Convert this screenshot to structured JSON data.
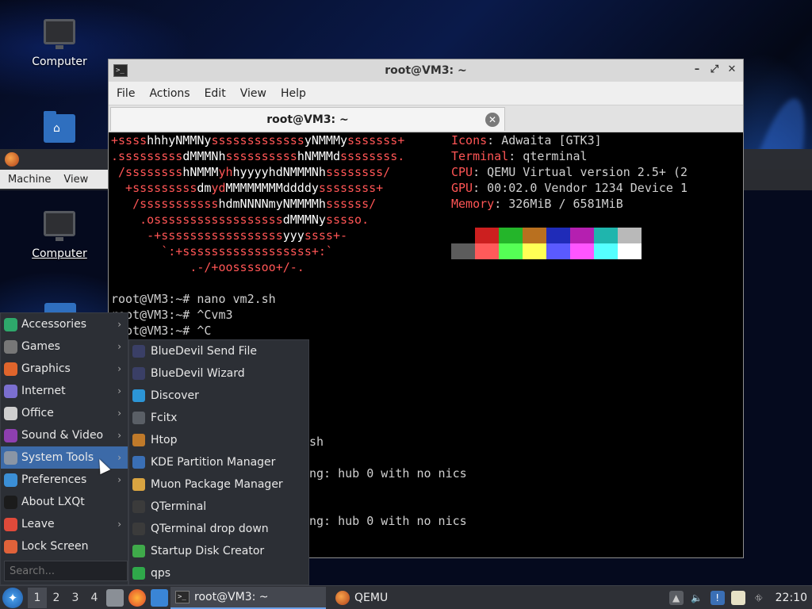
{
  "desktop": {
    "icons": [
      {
        "label": "Computer"
      },
      {
        "label": "Computer"
      }
    ]
  },
  "qemu": {
    "menubar": [
      "Machine",
      "View"
    ]
  },
  "terminal": {
    "window_title": "root@VM3: ~",
    "menubar": [
      "File",
      "Actions",
      "Edit",
      "View",
      "Help"
    ],
    "tab_title": "root@VM3: ~",
    "ascii_art": [
      {
        "segments": [
          [
            "red",
            "+ssss"
          ],
          [
            "w",
            "hhhyNMMNy"
          ],
          [
            "red",
            "sssssssssssss"
          ],
          [
            "w",
            "yNMMMy"
          ],
          [
            "red",
            "sssssss+"
          ]
        ]
      },
      {
        "segments": [
          [
            "red",
            ".sssssssss"
          ],
          [
            "w",
            "dMMMNh"
          ],
          [
            "red",
            "ssssssssss"
          ],
          [
            "w",
            "hNMMMd"
          ],
          [
            "red",
            "ssssssss."
          ]
        ]
      },
      {
        "segments": [
          [
            "red",
            " /ssssssss"
          ],
          [
            "w",
            "hNMMM"
          ],
          [
            "red",
            "yh"
          ],
          [
            "w",
            "hyyyyhdNMMMNh"
          ],
          [
            "red",
            "ssssssss/"
          ]
        ]
      },
      {
        "segments": [
          [
            "red",
            "  +sssssssss"
          ],
          [
            "w",
            "dm"
          ],
          [
            "red",
            "yd"
          ],
          [
            "w",
            "MMMMMMMMddddy"
          ],
          [
            "red",
            "ssssssss+"
          ]
        ]
      },
      {
        "segments": [
          [
            "red",
            "   /sssssssssss"
          ],
          [
            "w",
            "hdmNNNNmyNMMMMh"
          ],
          [
            "red",
            "ssssss/"
          ]
        ]
      },
      {
        "segments": [
          [
            "red",
            "    .ossssssssssssssssss"
          ],
          [
            "w",
            "dMMMNy"
          ],
          [
            "red",
            "sssso."
          ]
        ]
      },
      {
        "segments": [
          [
            "red",
            "     -+sssssssssssssssss"
          ],
          [
            "w",
            "yyy"
          ],
          [
            "red",
            "ssss+-"
          ]
        ]
      },
      {
        "segments": [
          [
            "red",
            "       `:+ssssssssssssssssss+:`"
          ]
        ]
      },
      {
        "segments": [
          [
            "red",
            "           .-/+oossssoo+/-."
          ]
        ]
      }
    ],
    "sysinfo": [
      {
        "label": "Icons",
        "value": "Adwaita [GTK3]"
      },
      {
        "label": "Terminal",
        "value": "qterminal"
      },
      {
        "label": "CPU",
        "value": "QEMU Virtual version 2.5+ (2"
      },
      {
        "label": "GPU",
        "value": "00:02.0 Vendor 1234 Device 1"
      },
      {
        "label": "Memory",
        "value": "326MiB / 6581MiB"
      }
    ],
    "palette_top": [
      "#000000",
      "#cc1f1f",
      "#24b52a",
      "#b9701f",
      "#1f2bb8",
      "#b51fb0",
      "#1fb5ad",
      "#b9b9b9"
    ],
    "palette_bottom": [
      "#5c5c5c",
      "#ff5a5a",
      "#55ff55",
      "#ffff55",
      "#5a5aff",
      "#ff55ff",
      "#55ffff",
      "#ffffff"
    ],
    "lines": [
      "root@VM3:~# nano vm2.sh",
      "root@VM3:~# ^Cvm3",
      "root@VM3:~# ^C",
      "sh",
      "ng: hub 0 with no nics",
      "ng: hub 0 with no nics"
    ]
  },
  "start_menu": {
    "items": [
      {
        "label": "Accessories",
        "icon": "accessories-icon",
        "color": "#2ea86b",
        "submenu": true
      },
      {
        "label": "Games",
        "icon": "games-icon",
        "color": "#777777",
        "submenu": true
      },
      {
        "label": "Graphics",
        "icon": "graphics-icon",
        "color": "#e0652c",
        "submenu": true
      },
      {
        "label": "Internet",
        "icon": "internet-icon",
        "color": "#7b6fd0",
        "submenu": true
      },
      {
        "label": "Office",
        "icon": "office-icon",
        "color": "#cfcfcf",
        "submenu": true
      },
      {
        "label": "Sound & Video",
        "icon": "sound-video-icon",
        "color": "#8e3fb0",
        "submenu": true
      },
      {
        "label": "System Tools",
        "icon": "system-tools-icon",
        "color": "#8a95a5",
        "submenu": true
      },
      {
        "label": "Preferences",
        "icon": "preferences-icon",
        "color": "#3b8fd6",
        "submenu": true
      },
      {
        "label": "About LXQt",
        "icon": "about-icon",
        "color": "#1b1b1b",
        "submenu": false
      },
      {
        "label": "Leave",
        "icon": "leave-icon",
        "color": "#e04a3a",
        "submenu": true
      },
      {
        "label": "Lock Screen",
        "icon": "lock-icon",
        "color": "#e0623a",
        "submenu": false
      }
    ],
    "search_placeholder": "Search...",
    "submenu": [
      {
        "label": "BlueDevil Send File",
        "icon": "bluetooth-icon",
        "color": "#3a3f66"
      },
      {
        "label": "BlueDevil Wizard",
        "icon": "bluetooth-icon",
        "color": "#3a3f66"
      },
      {
        "label": "Discover",
        "icon": "discover-icon",
        "color": "#2c95d6"
      },
      {
        "label": "Fcitx",
        "icon": "keyboard-icon",
        "color": "#5a5f66"
      },
      {
        "label": "Htop",
        "icon": "htop-icon",
        "color": "#c07a2a"
      },
      {
        "label": "KDE Partition Manager",
        "icon": "partition-icon",
        "color": "#3a6fb5"
      },
      {
        "label": "Muon Package Manager",
        "icon": "package-icon",
        "color": "#d9a441"
      },
      {
        "label": "QTerminal",
        "icon": "terminal-icon",
        "color": "#3b3b3b"
      },
      {
        "label": "QTerminal drop down",
        "icon": "terminal-icon",
        "color": "#3b3b3b"
      },
      {
        "label": "Startup Disk Creator",
        "icon": "disk-creator-icon",
        "color": "#3faa4a"
      },
      {
        "label": "qps",
        "icon": "qps-icon",
        "color": "#2fa84a"
      }
    ]
  },
  "taskbar": {
    "workspaces": [
      "1",
      "2",
      "3",
      "4"
    ],
    "tasks": [
      {
        "label": "root@VM3: ~",
        "icon": "terminal-icon"
      },
      {
        "label": "QEMU",
        "icon": "qemu-icon"
      }
    ],
    "clock": "22:10"
  }
}
